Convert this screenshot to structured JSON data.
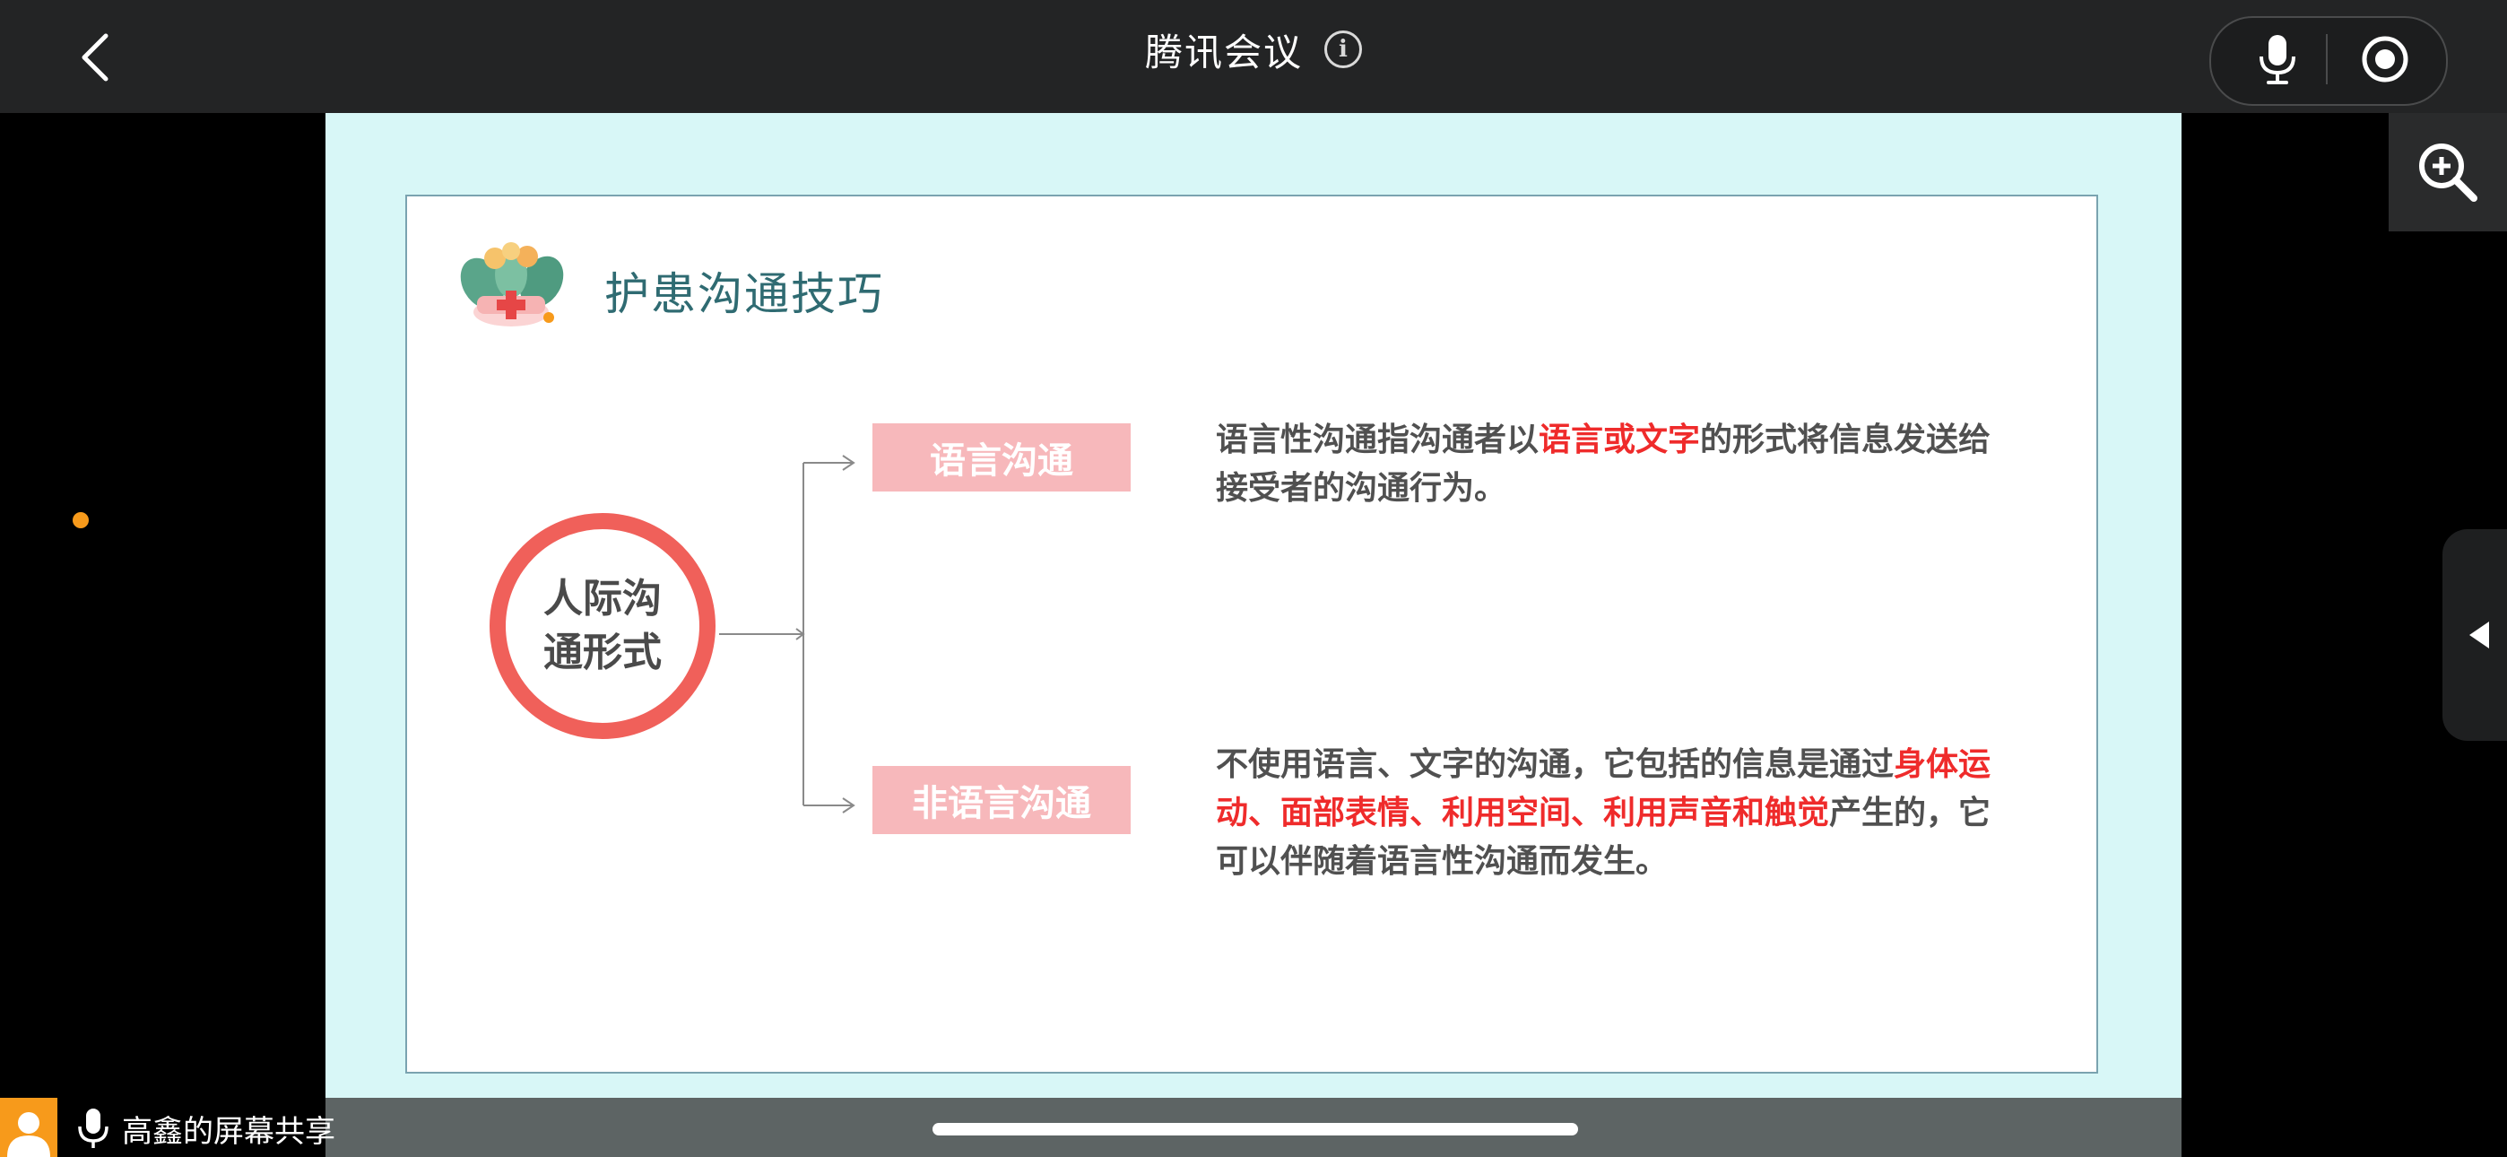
{
  "header": {
    "title": "腾讯会议",
    "back_icon": "chevron-left-icon",
    "info_icon": "info-icon",
    "info_glyph": "i",
    "mic_icon": "microphone-icon",
    "record_icon": "record-icon"
  },
  "side": {
    "zoom_icon": "zoom-in-icon",
    "collapse_icon": "triangle-left-icon"
  },
  "slide": {
    "title": "护患沟通技巧",
    "center": "人际沟通形式",
    "center_line1": "人际沟",
    "center_line2": "通形式",
    "branches": [
      {
        "label": "语言沟通",
        "desc_parts": [
          {
            "text": "语言性沟通指沟通者以",
            "highlight": false
          },
          {
            "text": "语言或文字",
            "highlight": true
          },
          {
            "text": "的形式将信息发送给接受者的沟通行为。",
            "highlight": false
          }
        ]
      },
      {
        "label": "非语言沟通",
        "desc_parts": [
          {
            "text": "不使用语言、文字的沟通，它包括的信息是通过",
            "highlight": false
          },
          {
            "text": "身体运动、面部表情、利用空间、利用声音和触觉",
            "highlight": true
          },
          {
            "text": "产生的，它可以伴随着语言性沟通而发生。",
            "highlight": false
          }
        ]
      }
    ],
    "colors": {
      "highlight": "#ef2b2b",
      "box": "#f7b8bb",
      "ring": "#f0605a",
      "title": "#2f6b72"
    }
  },
  "footer": {
    "share_label": "高鑫的屏幕共享"
  }
}
